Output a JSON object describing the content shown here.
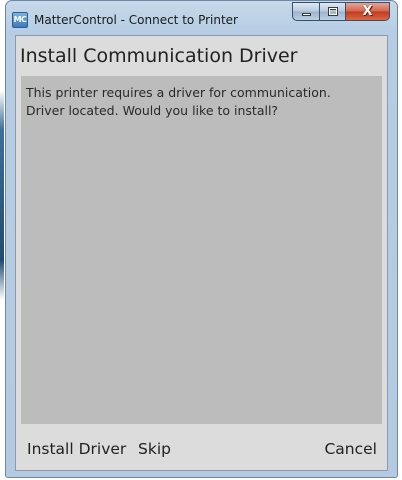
{
  "window": {
    "app_icon_text": "MC",
    "title": "MatterControl - Connect to Printer",
    "controls": {
      "minimize": "minimize-icon",
      "maximize": "maximize-icon",
      "close": "close-icon",
      "close_glyph": "X"
    }
  },
  "dialog": {
    "heading": "Install Communication Driver",
    "message_lines": [
      "This printer requires a driver for communication.",
      "Driver located. Would you like to install?"
    ],
    "buttons": {
      "install": "Install Driver",
      "skip": "Skip",
      "cancel": "Cancel"
    }
  },
  "colors": {
    "client_background": "#dcdcdc",
    "message_panel": "#bcbcbc",
    "close_button": "#c2391b",
    "window_frame": "#b6cde3"
  }
}
